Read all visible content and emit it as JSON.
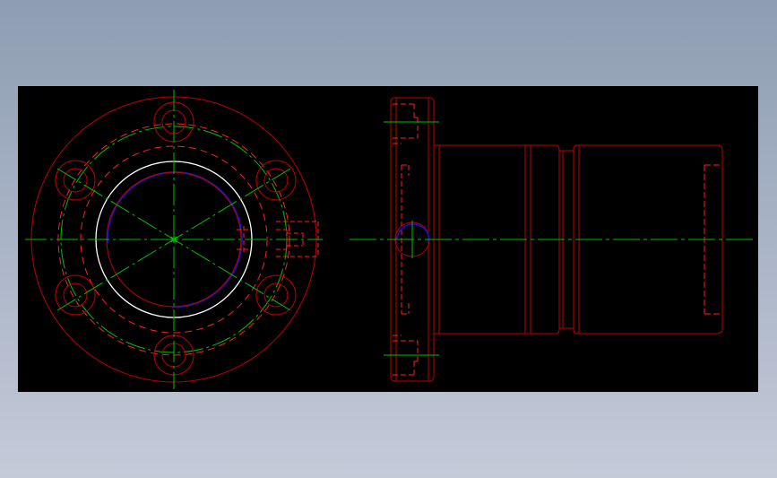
{
  "drawing": {
    "background_color": "#000000",
    "page_background": [
      "#8e9db2",
      "#c4cad8"
    ],
    "colors": {
      "outline": "#c00000",
      "hidden": "#ff2020",
      "centerline": "#00c000",
      "bore": "#ffffff",
      "thread": "#1010d0"
    },
    "views": [
      {
        "name": "front-view"
      },
      {
        "name": "side-view"
      }
    ]
  }
}
